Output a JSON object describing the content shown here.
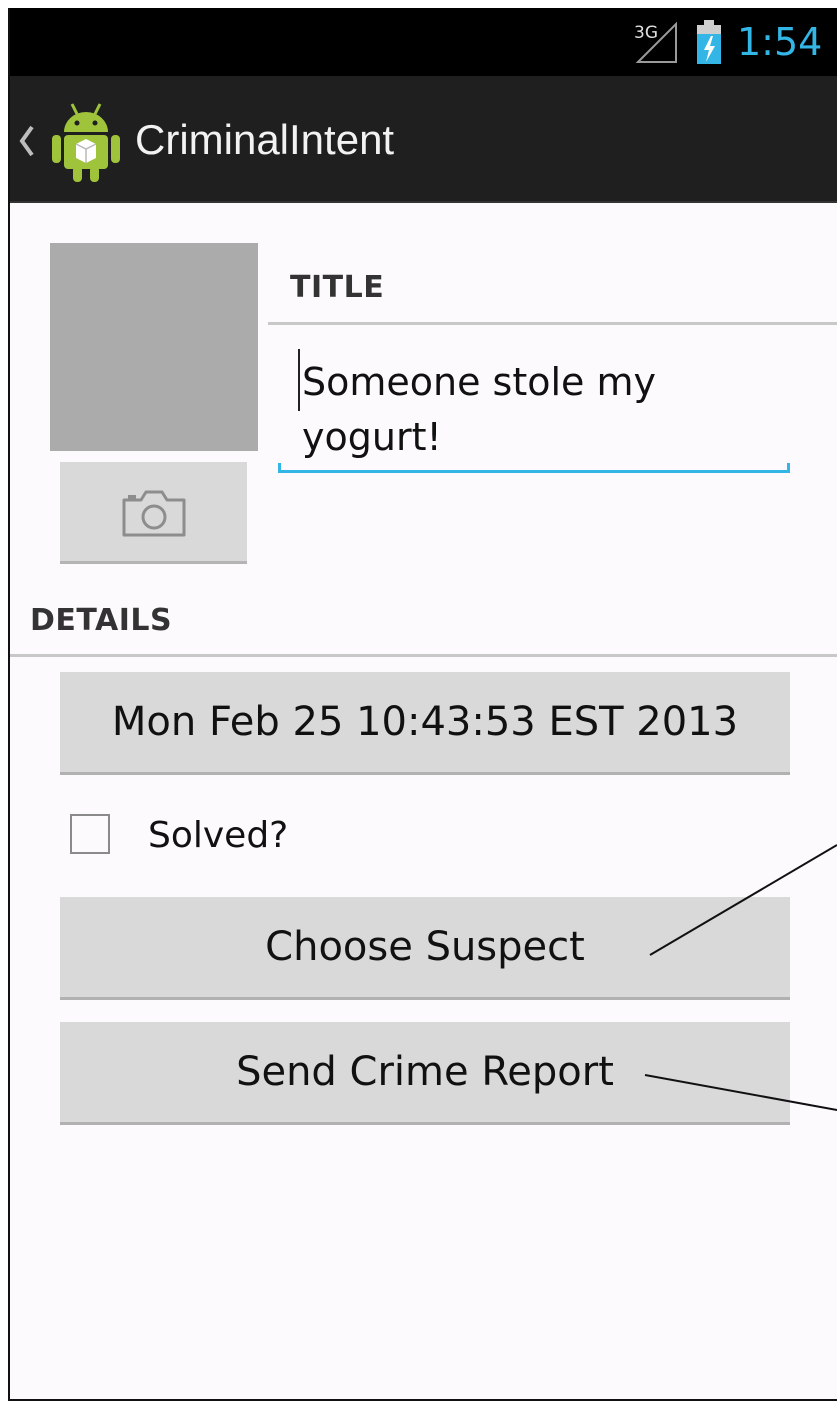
{
  "status_bar": {
    "network_label": "3G",
    "time": "1:54",
    "accent_color": "#33b5e5"
  },
  "action_bar": {
    "title": "CriminalIntent",
    "icon": "android-app-icon"
  },
  "photo": {
    "camera_button_icon": "camera-icon"
  },
  "title_section": {
    "label": "TITLE",
    "value": "Someone stole my\nyogurt!"
  },
  "details_section": {
    "label": "DETAILS",
    "date_button": "Mon Feb 25 10:43:53 EST 2013",
    "solved_label": "Solved?",
    "solved_checked": false,
    "suspect_button": "Choose Suspect",
    "report_button": "Send Crime Report"
  }
}
